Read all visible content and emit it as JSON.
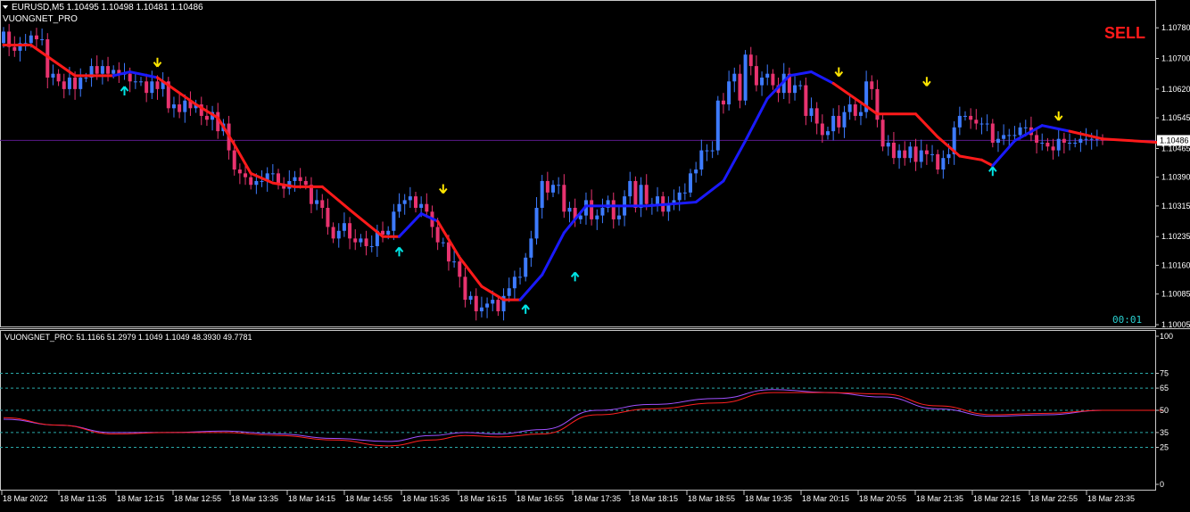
{
  "header": {
    "symbol_line": "EURUSD,M5  1.10495 1.10498 1.10481 1.10486",
    "indicator_name": "VUONGNET_PRO"
  },
  "signal": {
    "text": "SELL",
    "color": "#ff1a1a"
  },
  "countdown": "00:01",
  "colors": {
    "background": "#000000",
    "bull_candle": "#3d7bff",
    "bear_candle": "#e8336f",
    "trend_up": "#1a1aff",
    "trend_down": "#ff1a1a",
    "buy_arrow": "#00e5e5",
    "sell_arrow": "#ffe600",
    "price_line": "#5a1a8a",
    "osc_fast": "#a050ff",
    "osc_slow": "#ff2020",
    "level_lines": "#2aa9a9"
  },
  "chart_data": [
    {
      "type": "candlestick",
      "title": "EURUSD,M5",
      "current_price_label": "1.10486",
      "y_ticks": [
        "1.10780",
        "1.10700",
        "1.10620",
        "1.10545",
        "1.10465",
        "1.10390",
        "1.10315",
        "1.10235",
        "1.10160",
        "1.10085",
        "1.10005"
      ],
      "y_tick_values": [
        1.1078,
        1.107,
        1.1062,
        1.10545,
        1.10465,
        1.1039,
        1.10315,
        1.10235,
        1.1016,
        1.10085,
        1.10005
      ],
      "ylim": [
        1.10005,
        1.10785
      ],
      "current_price": 1.10486,
      "trend_line": [
        {
          "t": 0,
          "v": 1.10735,
          "c": "down"
        },
        {
          "t": 5,
          "v": 1.10735,
          "c": "down"
        },
        {
          "t": 13,
          "v": 1.10655,
          "c": "down"
        },
        {
          "t": 20,
          "v": 1.10655,
          "c": "up"
        },
        {
          "t": 23,
          "v": 1.10665,
          "c": "up"
        },
        {
          "t": 28,
          "v": 1.1065,
          "c": "down"
        },
        {
          "t": 35,
          "v": 1.1058,
          "c": "down"
        },
        {
          "t": 39,
          "v": 1.10545,
          "c": "down"
        },
        {
          "t": 42,
          "v": 1.10475,
          "c": "down"
        },
        {
          "t": 45,
          "v": 1.104,
          "c": "down"
        },
        {
          "t": 49,
          "v": 1.10375,
          "c": "down"
        },
        {
          "t": 53,
          "v": 1.10365,
          "c": "down"
        },
        {
          "t": 58,
          "v": 1.10365,
          "c": "down"
        },
        {
          "t": 63,
          "v": 1.10305,
          "c": "down"
        },
        {
          "t": 69,
          "v": 1.10235,
          "c": "down"
        },
        {
          "t": 72,
          "v": 1.10235,
          "c": "up"
        },
        {
          "t": 76,
          "v": 1.10295,
          "c": "up"
        },
        {
          "t": 79,
          "v": 1.10275,
          "c": "down"
        },
        {
          "t": 83,
          "v": 1.1018,
          "c": "down"
        },
        {
          "t": 87,
          "v": 1.10105,
          "c": "down"
        },
        {
          "t": 91,
          "v": 1.1007,
          "c": "down"
        },
        {
          "t": 94,
          "v": 1.1007,
          "c": "up"
        },
        {
          "t": 98,
          "v": 1.10135,
          "c": "up"
        },
        {
          "t": 102,
          "v": 1.10245,
          "c": "up"
        },
        {
          "t": 106,
          "v": 1.10315,
          "c": "up"
        },
        {
          "t": 117,
          "v": 1.10315,
          "c": "up"
        },
        {
          "t": 126,
          "v": 1.10325,
          "c": "up"
        },
        {
          "t": 131,
          "v": 1.1038,
          "c": "up"
        },
        {
          "t": 135,
          "v": 1.10485,
          "c": "up"
        },
        {
          "t": 139,
          "v": 1.10595,
          "c": "up"
        },
        {
          "t": 143,
          "v": 1.10655,
          "c": "up"
        },
        {
          "t": 147,
          "v": 1.10665,
          "c": "up"
        },
        {
          "t": 151,
          "v": 1.10635,
          "c": "down"
        },
        {
          "t": 156,
          "v": 1.10585,
          "c": "down"
        },
        {
          "t": 159,
          "v": 1.10555,
          "c": "down"
        },
        {
          "t": 166,
          "v": 1.10555,
          "c": "down"
        },
        {
          "t": 170,
          "v": 1.10495,
          "c": "down"
        },
        {
          "t": 174,
          "v": 1.10445,
          "c": "down"
        },
        {
          "t": 178,
          "v": 1.10435,
          "c": "down"
        },
        {
          "t": 180,
          "v": 1.1042,
          "c": "up"
        },
        {
          "t": 184,
          "v": 1.10485,
          "c": "up"
        },
        {
          "t": 189,
          "v": 1.10525,
          "c": "up"
        },
        {
          "t": 194,
          "v": 1.1051,
          "c": "down"
        },
        {
          "t": 200,
          "v": 1.1049,
          "c": "down"
        },
        {
          "t": 211,
          "v": 1.1048,
          "c": "down"
        }
      ],
      "candles_o": [
        1.1074,
        1.1077,
        1.1073,
        1.1072,
        1.1074,
        1.1074,
        1.1076,
        1.1075,
        1.1075,
        1.1065,
        1.1066,
        1.1064,
        1.1062,
        1.1065,
        1.1062,
        1.1065,
        1.1065,
        1.1068,
        1.1066,
        1.1068,
        1.1066,
        1.1067,
        1.1066,
        1.1066,
        1.1064,
        1.1064,
        1.1064,
        1.1061,
        1.1064,
        1.1062,
        1.1064,
        1.1057,
        1.1058,
        1.1056,
        1.1059,
        1.1057,
        1.1058,
        1.1055,
        1.1054,
        1.1056,
        1.1051,
        1.1053,
        1.1046,
        1.1041,
        1.104,
        1.1039,
        1.1037,
        1.1038,
        1.1038,
        1.104,
        1.104,
        1.1037,
        1.1036,
        1.1038,
        1.1039,
        1.1038,
        1.1037,
        1.1032,
        1.1033,
        1.1031,
        1.1026,
        1.1023,
        1.1025,
        1.1027,
        1.1023,
        1.1022,
        1.1023,
        1.1021,
        1.1021,
        1.1025,
        1.1024,
        1.1025,
        1.103,
        1.1032,
        1.1033,
        1.1034,
        1.1031,
        1.1032,
        1.103,
        1.1026,
        1.1022,
        1.1022,
        1.1017,
        1.1017,
        1.1013,
        1.1007,
        1.1008,
        1.1004,
        1.1005,
        1.1006,
        1.1007,
        1.1004,
        1.1008,
        1.101,
        1.1013,
        1.1013,
        1.1018,
        1.1023,
        1.1031,
        1.1038,
        1.1035,
        1.1037,
        1.1037,
        1.103,
        1.1031,
        1.1028,
        1.1029,
        1.1033,
        1.1028,
        1.1029,
        1.1031,
        1.1033,
        1.1028,
        1.1029,
        1.1034,
        1.1038,
        1.1031,
        1.1037,
        1.1032,
        1.1032,
        1.1034,
        1.103,
        1.1032,
        1.1033,
        1.1035,
        1.1035,
        1.104,
        1.1041,
        1.1046,
        1.1046,
        1.1046,
        1.1059,
        1.1058,
        1.1064,
        1.1066,
        1.1059,
        1.1071,
        1.1068,
        1.1063,
        1.1065,
        1.1066,
        1.1063,
        1.1061,
        1.1066,
        1.1061,
        1.1063,
        1.1063,
        1.1055,
        1.1057,
        1.1053,
        1.105,
        1.1051,
        1.1055,
        1.1052,
        1.1056,
        1.1058,
        1.1055,
        1.1056,
        1.1064,
        1.1062,
        1.1054,
        1.1047,
        1.1048,
        1.1044,
        1.1046,
        1.1044,
        1.1047,
        1.1043,
        1.1046,
        1.1045,
        1.1045,
        1.1041,
        1.1044,
        1.1045,
        1.1052,
        1.1055,
        1.1055,
        1.1054,
        1.1053,
        1.1053,
        1.1053,
        1.1048,
        1.1049,
        1.105,
        1.105,
        1.105,
        1.1052,
        1.1052,
        1.105,
        1.1048,
        1.1048,
        1.1047,
        1.1046,
        1.1049,
        1.1048,
        1.1048,
        1.1048,
        1.1049,
        1.1049,
        1.1049,
        1.1049
      ],
      "candles_c": [
        1.1077,
        1.1073,
        1.1072,
        1.1074,
        1.1074,
        1.1076,
        1.1075,
        1.1075,
        1.1065,
        1.1066,
        1.1064,
        1.1062,
        1.1065,
        1.1062,
        1.1065,
        1.1065,
        1.1068,
        1.1066,
        1.1068,
        1.1066,
        1.1067,
        1.1066,
        1.1066,
        1.1064,
        1.1064,
        1.1064,
        1.1061,
        1.1064,
        1.1062,
        1.1064,
        1.1057,
        1.1058,
        1.1056,
        1.1059,
        1.1057,
        1.1058,
        1.1055,
        1.1054,
        1.1056,
        1.1051,
        1.1053,
        1.1046,
        1.1041,
        1.104,
        1.1039,
        1.1037,
        1.1038,
        1.1038,
        1.104,
        1.104,
        1.1037,
        1.1036,
        1.1038,
        1.1039,
        1.1038,
        1.1037,
        1.1032,
        1.1033,
        1.1031,
        1.1026,
        1.1023,
        1.1025,
        1.1027,
        1.1023,
        1.1022,
        1.1023,
        1.1021,
        1.1021,
        1.1025,
        1.1024,
        1.1025,
        1.103,
        1.1032,
        1.1033,
        1.1034,
        1.1031,
        1.1032,
        1.103,
        1.1026,
        1.1022,
        1.1022,
        1.1017,
        1.1017,
        1.1013,
        1.1007,
        1.1008,
        1.1004,
        1.1005,
        1.1006,
        1.1007,
        1.1004,
        1.1008,
        1.101,
        1.1013,
        1.1013,
        1.1018,
        1.1023,
        1.1031,
        1.1038,
        1.1035,
        1.1037,
        1.1037,
        1.103,
        1.1031,
        1.1028,
        1.1029,
        1.1033,
        1.1028,
        1.1029,
        1.1031,
        1.1033,
        1.1028,
        1.1029,
        1.1034,
        1.1038,
        1.1031,
        1.1037,
        1.1032,
        1.1032,
        1.1034,
        1.103,
        1.1032,
        1.1033,
        1.1035,
        1.1035,
        1.104,
        1.1041,
        1.1046,
        1.1046,
        1.1046,
        1.1059,
        1.1058,
        1.1064,
        1.1066,
        1.1059,
        1.1071,
        1.1068,
        1.1063,
        1.1065,
        1.1066,
        1.1063,
        1.1061,
        1.1066,
        1.1061,
        1.1063,
        1.1063,
        1.1055,
        1.1057,
        1.1053,
        1.105,
        1.1051,
        1.1055,
        1.1052,
        1.1056,
        1.1058,
        1.1055,
        1.1056,
        1.1064,
        1.1062,
        1.1054,
        1.1047,
        1.1048,
        1.1044,
        1.1046,
        1.1044,
        1.1047,
        1.1043,
        1.1046,
        1.1045,
        1.1045,
        1.1041,
        1.1044,
        1.1045,
        1.1052,
        1.1055,
        1.1055,
        1.1054,
        1.1053,
        1.1053,
        1.1053,
        1.1048,
        1.1049,
        1.105,
        1.105,
        1.105,
        1.1052,
        1.1052,
        1.105,
        1.1048,
        1.1048,
        1.1047,
        1.1046,
        1.1049,
        1.1048,
        1.1048,
        1.1048,
        1.1049,
        1.1049,
        1.1049,
        1.1049,
        1.10486
      ],
      "buy_signals": [
        {
          "t": 22,
          "v": 1.10615
        },
        {
          "t": 72,
          "v": 1.10195
        },
        {
          "t": 95,
          "v": 1.10045
        },
        {
          "t": 104,
          "v": 1.1013
        },
        {
          "t": 180,
          "v": 1.10405
        }
      ],
      "sell_signals": [
        {
          "t": 28,
          "v": 1.1069
        },
        {
          "t": 80,
          "v": 1.1036
        },
        {
          "t": 152,
          "v": 1.10665
        },
        {
          "t": 168,
          "v": 1.1064
        },
        {
          "t": 192,
          "v": 1.1055
        }
      ]
    },
    {
      "type": "line",
      "title": "VUONGNET_PRO",
      "values_label": "VUONGNET_PRO:  51.1166 51.2979 1.1049 1.1049 48.3930 49.7781",
      "y_ticks": [
        "100",
        "75",
        "65",
        "50",
        "35",
        "25",
        "0"
      ],
      "y_tick_values": [
        100,
        75,
        65,
        50,
        35,
        25,
        0
      ],
      "levels": [
        75,
        65,
        50,
        35,
        25
      ],
      "ylim": [
        0,
        100
      ],
      "series": [
        {
          "key": "fast",
          "points": [
            [
              0,
              44
            ],
            [
              10,
              40
            ],
            [
              20,
              35
            ],
            [
              30,
              35
            ],
            [
              40,
              36
            ],
            [
              50,
              34
            ],
            [
              60,
              31
            ],
            [
              70,
              29
            ],
            [
              78,
              33
            ],
            [
              84,
              35
            ],
            [
              90,
              34
            ],
            [
              98,
              37
            ],
            [
              108,
              50
            ],
            [
              118,
              54
            ],
            [
              130,
              58
            ],
            [
              140,
              64
            ],
            [
              150,
              62
            ],
            [
              160,
              59
            ],
            [
              170,
              51
            ],
            [
              180,
              46
            ],
            [
              190,
              47
            ],
            [
              200,
              50
            ],
            [
              211,
              50
            ]
          ]
        },
        {
          "key": "slow",
          "points": [
            [
              0,
              45
            ],
            [
              10,
              40
            ],
            [
              20,
              34
            ],
            [
              30,
              35
            ],
            [
              40,
              35
            ],
            [
              50,
              33
            ],
            [
              60,
              30
            ],
            [
              70,
              26
            ],
            [
              78,
              30
            ],
            [
              84,
              33
            ],
            [
              90,
              32
            ],
            [
              98,
              34
            ],
            [
              108,
              47
            ],
            [
              118,
              51
            ],
            [
              130,
              55
            ],
            [
              140,
              62
            ],
            [
              150,
              62
            ],
            [
              160,
              61
            ],
            [
              170,
              53
            ],
            [
              180,
              47
            ],
            [
              190,
              48
            ],
            [
              200,
              50
            ],
            [
              211,
              50
            ]
          ]
        }
      ]
    }
  ],
  "time_axis": [
    "18 Mar 2022",
    "18 Mar 11:35",
    "18 Mar 12:15",
    "18 Mar 12:55",
    "18 Mar 13:35",
    "18 Mar 14:15",
    "18 Mar 14:55",
    "18 Mar 15:35",
    "18 Mar 16:15",
    "18 Mar 16:55",
    "18 Mar 17:35",
    "18 Mar 18:15",
    "18 Mar 18:55",
    "18 Mar 19:35",
    "18 Mar 20:15",
    "18 Mar 20:55",
    "18 Mar 21:35",
    "18 Mar 22:15",
    "18 Mar 22:55",
    "18 Mar 23:35"
  ]
}
